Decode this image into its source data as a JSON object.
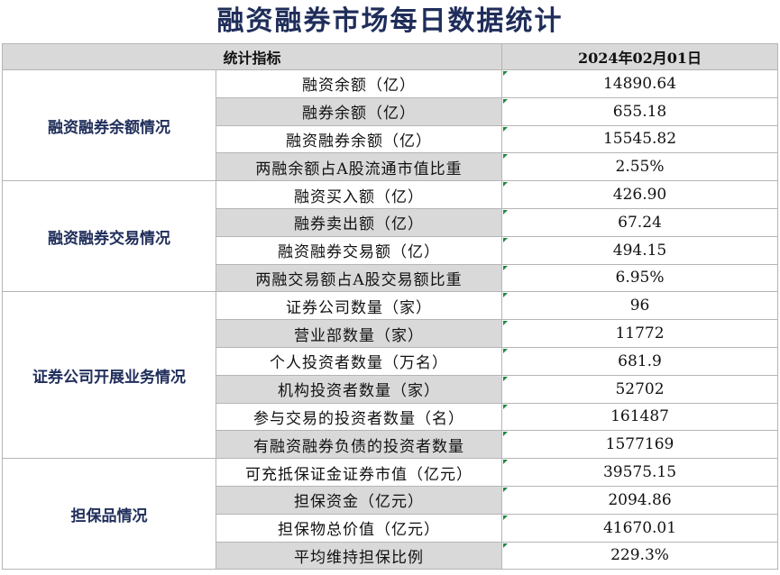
{
  "title": "融资融券市场每日数据统计",
  "header": {
    "indicator": "统计指标",
    "date": "2024年02月01日"
  },
  "groups": [
    {
      "name": "融资融券余额情况",
      "rows": [
        {
          "label": "融资余额（亿）",
          "value": "14890.64"
        },
        {
          "label": "融券余额（亿）",
          "value": "655.18"
        },
        {
          "label": "融资融券余额（亿）",
          "value": "15545.82"
        },
        {
          "label": "两融余额占A股流通市值比重",
          "value": "2.55%"
        }
      ]
    },
    {
      "name": "融资融券交易情况",
      "rows": [
        {
          "label": "融资买入额（亿）",
          "value": "426.90"
        },
        {
          "label": "融券卖出额（亿）",
          "value": "67.24"
        },
        {
          "label": "融资融券交易额（亿）",
          "value": "494.15"
        },
        {
          "label": "两融交易额占A股交易额比重",
          "value": "6.95%"
        }
      ]
    },
    {
      "name": "证券公司开展业务情况",
      "rows": [
        {
          "label": "证券公司数量（家）",
          "value": "96"
        },
        {
          "label": "营业部数量（家）",
          "value": "11772"
        },
        {
          "label": "个人投资者数量（万名）",
          "value": "681.9"
        },
        {
          "label": "机构投资者数量（家）",
          "value": "52702"
        },
        {
          "label": "参与交易的投资者数量（名）",
          "value": "161487"
        },
        {
          "label": "有融资融券负债的投资者数量",
          "value": "1577169"
        }
      ]
    },
    {
      "name": "担保品情况",
      "rows": [
        {
          "label": "可充抵保证金证券市值（亿元）",
          "value": "39575.15"
        },
        {
          "label": "担保资金（亿元）",
          "value": "2094.86"
        },
        {
          "label": "担保物总价值（亿元）",
          "value": "41670.01"
        },
        {
          "label": "平均维持担保比例",
          "value": "229.3%"
        }
      ]
    }
  ]
}
